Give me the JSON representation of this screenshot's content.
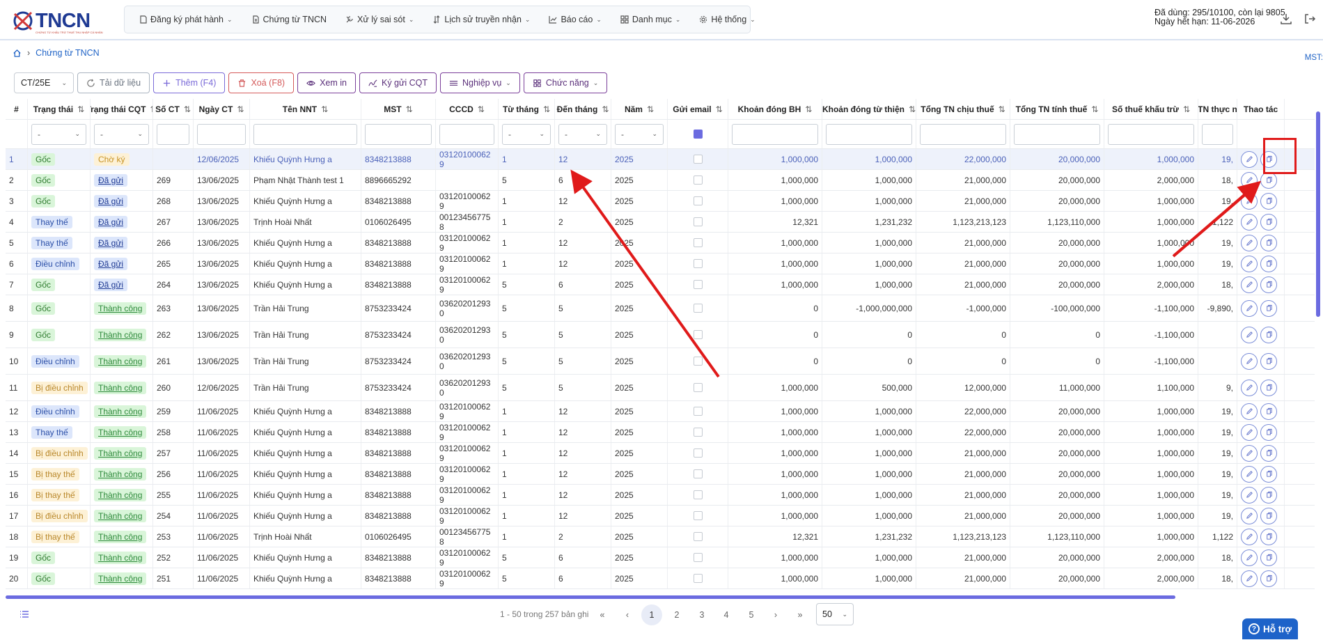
{
  "header": {
    "logo": "TNCN",
    "logo_sub": "CHỨNG TỪ KHẤU TRỪ THUẾ THU NHẬP CÁ NHÂN",
    "nav": [
      {
        "label": "Đăng ký phát hành",
        "icon": "document-icon"
      },
      {
        "label": "Chứng từ TNCN",
        "icon": "file-icon"
      },
      {
        "label": "Xử lý sai sót",
        "icon": "tools-icon"
      },
      {
        "label": "Lịch sử truyền nhận",
        "icon": "arrows-icon"
      },
      {
        "label": "Báo cáo",
        "icon": "chart-icon"
      },
      {
        "label": "Danh mục",
        "icon": "grid-icon"
      },
      {
        "label": "Hệ thống",
        "icon": "gear-icon"
      }
    ],
    "usage_line1": "Đã dùng: 295/10100, còn lại 9805",
    "usage_line2": "Ngày hết hạn: 11-06-2026"
  },
  "breadcrumb": {
    "current": "Chứng từ TNCN"
  },
  "mst_label": "MST:",
  "toolbar": {
    "select_value": "CT/25E",
    "reload": "Tải dữ liệu",
    "add": "Thêm (F4)",
    "delete": "Xoá (F8)",
    "view": "Xem in",
    "sign": "Ký gửi CQT",
    "business": "Nghiệp vụ",
    "functions": "Chức năng"
  },
  "table": {
    "columns": [
      "#",
      "Trạng thái",
      "Trạng thái CQT",
      "Số CT",
      "Ngày CT",
      "Tên NNT",
      "MST",
      "CCCD",
      "Từ tháng",
      "Đến tháng",
      "Năm",
      "Gửi email",
      "Khoản đóng BH",
      "Khoản đóng từ thiện",
      "Tổng TN chịu thuế",
      "Tổng TN tính thuế",
      "Số thuế khấu trừ",
      "TN thực n",
      "Thao tác"
    ],
    "filter_placeholder": "-",
    "rows": [
      [
        "1",
        "Gốc",
        "Chờ ký",
        "",
        "12/06/2025",
        "Khiếu Quỳnh Hưng a",
        "8348213888",
        "031201000629",
        "1",
        "12",
        "2025",
        "1,000,000",
        "1,000,000",
        "22,000,000",
        "20,000,000",
        "1,000,000",
        "19,"
      ],
      [
        "2",
        "Gốc",
        "Đã gửi",
        "269",
        "13/06/2025",
        "Phạm Nhật Thành test 1",
        "8896665292",
        "",
        "5",
        "6",
        "2025",
        "1,000,000",
        "1,000,000",
        "21,000,000",
        "20,000,000",
        "2,000,000",
        "18,"
      ],
      [
        "3",
        "Gốc",
        "Đã gửi",
        "268",
        "13/06/2025",
        "Khiếu Quỳnh Hưng a",
        "8348213888",
        "031201000629",
        "1",
        "12",
        "2025",
        "1,000,000",
        "1,000,000",
        "21,000,000",
        "20,000,000",
        "1,000,000",
        "19,"
      ],
      [
        "4",
        "Thay thế",
        "Đã gửi",
        "267",
        "13/06/2025",
        "Trịnh Hoài Nhất",
        "0106026495",
        "001234567758",
        "1",
        "2",
        "2025",
        "12,321",
        "1,231,232",
        "1,123,213,123",
        "1,123,110,000",
        "1,000,000",
        "1,122"
      ],
      [
        "5",
        "Thay thế",
        "Đã gửi",
        "266",
        "13/06/2025",
        "Khiếu Quỳnh Hưng a",
        "8348213888",
        "031201000629",
        "1",
        "12",
        "2025",
        "1,000,000",
        "1,000,000",
        "21,000,000",
        "20,000,000",
        "1,000,000",
        "19,"
      ],
      [
        "6",
        "Điều chỉnh",
        "Đã gửi",
        "265",
        "13/06/2025",
        "Khiếu Quỳnh Hưng a",
        "8348213888",
        "031201000629",
        "1",
        "12",
        "2025",
        "1,000,000",
        "1,000,000",
        "21,000,000",
        "20,000,000",
        "1,000,000",
        "19,"
      ],
      [
        "7",
        "Gốc",
        "Đã gửi",
        "264",
        "13/06/2025",
        "Khiếu Quỳnh Hưng a",
        "8348213888",
        "031201000629",
        "5",
        "6",
        "2025",
        "1,000,000",
        "1,000,000",
        "21,000,000",
        "20,000,000",
        "2,000,000",
        "18,"
      ],
      [
        "8",
        "Gốc",
        "Thành công",
        "263",
        "13/06/2025",
        "Trần Hải Trung",
        "8753233424",
        "036202012930",
        "5",
        "5",
        "2025",
        "0",
        "-1,000,000,000",
        "-1,000,000",
        "-100,000,000",
        "-1,100,000",
        "-9,890,"
      ],
      [
        "9",
        "Gốc",
        "Thành công",
        "262",
        "13/06/2025",
        "Trần Hải Trung",
        "8753233424",
        "036202012930",
        "5",
        "5",
        "2025",
        "0",
        "0",
        "0",
        "0",
        "-1,100,000",
        ""
      ],
      [
        "10",
        "Điều chỉnh",
        "Thành công",
        "261",
        "13/06/2025",
        "Trần Hải Trung",
        "8753233424",
        "036202012930",
        "5",
        "5",
        "2025",
        "0",
        "0",
        "0",
        "0",
        "-1,100,000",
        ""
      ],
      [
        "11",
        "Bị điều chỉnh",
        "Thành công",
        "260",
        "12/06/2025",
        "Trần Hải Trung",
        "8753233424",
        "036202012930",
        "5",
        "5",
        "2025",
        "1,000,000",
        "500,000",
        "12,000,000",
        "11,000,000",
        "1,100,000",
        "9,"
      ],
      [
        "12",
        "Điều chỉnh",
        "Thành công",
        "259",
        "11/06/2025",
        "Khiếu Quỳnh Hưng a",
        "8348213888",
        "031201000629",
        "1",
        "12",
        "2025",
        "1,000,000",
        "1,000,000",
        "22,000,000",
        "20,000,000",
        "1,000,000",
        "19,"
      ],
      [
        "13",
        "Thay thế",
        "Thành công",
        "258",
        "11/06/2025",
        "Khiếu Quỳnh Hưng a",
        "8348213888",
        "031201000629",
        "1",
        "12",
        "2025",
        "1,000,000",
        "1,000,000",
        "22,000,000",
        "20,000,000",
        "1,000,000",
        "19,"
      ],
      [
        "14",
        "Bị điều chỉnh",
        "Thành công",
        "257",
        "11/06/2025",
        "Khiếu Quỳnh Hưng a",
        "8348213888",
        "031201000629",
        "1",
        "12",
        "2025",
        "1,000,000",
        "1,000,000",
        "21,000,000",
        "20,000,000",
        "1,000,000",
        "19,"
      ],
      [
        "15",
        "Bị thay thế",
        "Thành công",
        "256",
        "11/06/2025",
        "Khiếu Quỳnh Hưng a",
        "8348213888",
        "031201000629",
        "1",
        "12",
        "2025",
        "1,000,000",
        "1,000,000",
        "21,000,000",
        "20,000,000",
        "1,000,000",
        "19,"
      ],
      [
        "16",
        "Bị thay thế",
        "Thành công",
        "255",
        "11/06/2025",
        "Khiếu Quỳnh Hưng a",
        "8348213888",
        "031201000629",
        "1",
        "12",
        "2025",
        "1,000,000",
        "1,000,000",
        "21,000,000",
        "20,000,000",
        "1,000,000",
        "19,"
      ],
      [
        "17",
        "Bị điều chỉnh",
        "Thành công",
        "254",
        "11/06/2025",
        "Khiếu Quỳnh Hưng a",
        "8348213888",
        "031201000629",
        "1",
        "12",
        "2025",
        "1,000,000",
        "1,000,000",
        "21,000,000",
        "20,000,000",
        "1,000,000",
        "19,"
      ],
      [
        "18",
        "Bị thay thế",
        "Thành công",
        "253",
        "11/06/2025",
        "Trịnh Hoài Nhất",
        "0106026495",
        "001234567758",
        "1",
        "2",
        "2025",
        "12,321",
        "1,231,232",
        "1,123,213,123",
        "1,123,110,000",
        "1,000,000",
        "1,122"
      ],
      [
        "19",
        "Gốc",
        "Thành công",
        "252",
        "11/06/2025",
        "Khiếu Quỳnh Hưng a",
        "8348213888",
        "031201000629",
        "5",
        "6",
        "2025",
        "1,000,000",
        "1,000,000",
        "21,000,000",
        "20,000,000",
        "2,000,000",
        "18,"
      ],
      [
        "20",
        "Gốc",
        "Thành công",
        "251",
        "11/06/2025",
        "Khiếu Quỳnh Hưng a",
        "8348213888",
        "031201000629",
        "5",
        "6",
        "2025",
        "1,000,000",
        "1,000,000",
        "21,000,000",
        "20,000,000",
        "2,000,000",
        "18,"
      ]
    ]
  },
  "pagination": {
    "info": "1 - 50 trong 257 bản ghi",
    "pages": [
      "1",
      "2",
      "3",
      "4",
      "5"
    ],
    "current": "1",
    "per_page": "50"
  },
  "help_button": "Hỗ trợ",
  "colors": {
    "accent": "#6b6be0",
    "brand": "#1f3a93",
    "highlight": "#e01a1a"
  }
}
